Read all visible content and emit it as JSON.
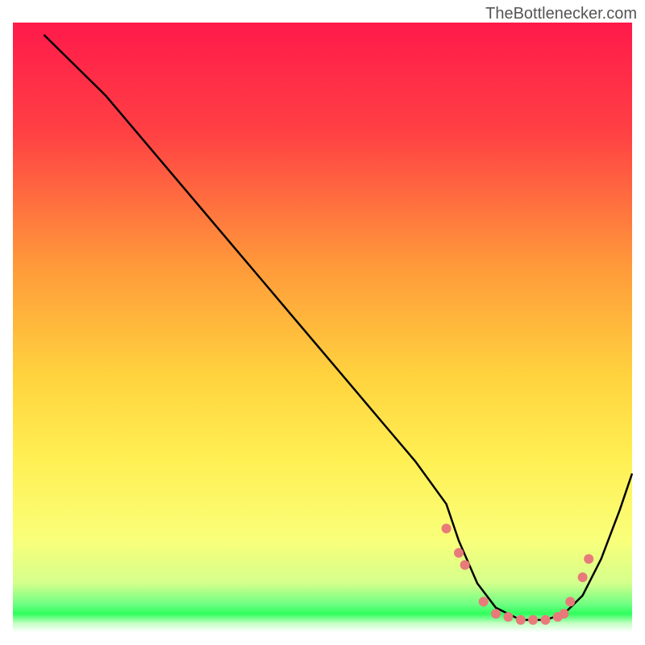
{
  "watermark": "TheBottlenecker.com",
  "chart_data": {
    "type": "line",
    "title": "",
    "xlabel": "",
    "ylabel": "",
    "xlim": [
      0,
      100
    ],
    "ylim": [
      0,
      100
    ],
    "background_gradient": {
      "top": "#ff1a4a",
      "mid_top": "#ff6b3d",
      "mid": "#ffd840",
      "mid_bottom": "#fff870",
      "green_band": "#2eff5c",
      "bottom": "#ffffff"
    },
    "series": [
      {
        "name": "bottleneck-curve",
        "color": "#000000",
        "x": [
          5,
          10,
          15,
          20,
          25,
          30,
          35,
          40,
          45,
          50,
          55,
          60,
          65,
          70,
          72,
          75,
          78,
          82,
          86,
          89,
          92,
          95,
          98,
          100
        ],
        "y": [
          98,
          93,
          88,
          82,
          76,
          70,
          64,
          58,
          52,
          46,
          40,
          34,
          28,
          21,
          15,
          8,
          4,
          2,
          2,
          3,
          6,
          12,
          20,
          26
        ]
      }
    ],
    "scatter_points": {
      "name": "highlight-dots",
      "color": "#e87a7a",
      "x": [
        70,
        72,
        73,
        76,
        78,
        80,
        82,
        84,
        86,
        88,
        89,
        90,
        92,
        93
      ],
      "y": [
        17,
        13,
        11,
        5,
        3,
        2.5,
        2,
        2,
        2,
        2.5,
        3,
        5,
        9,
        12
      ]
    }
  }
}
